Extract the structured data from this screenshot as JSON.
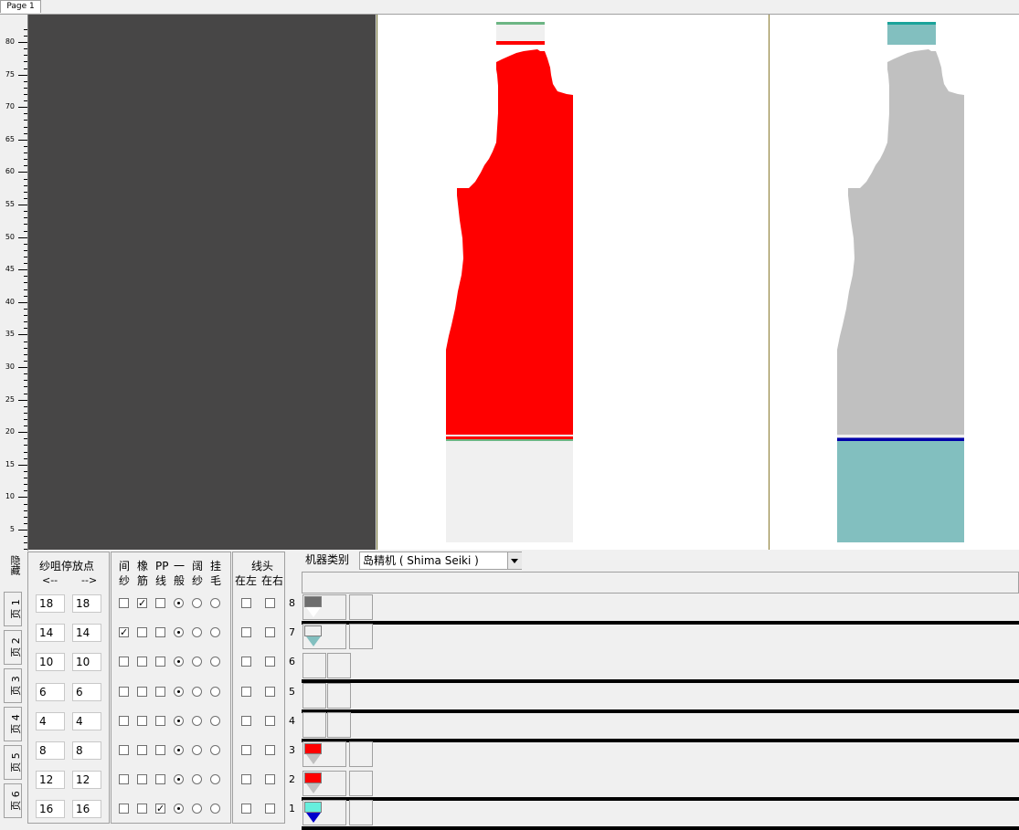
{
  "tabs": [
    {
      "label": "Page 1"
    }
  ],
  "ruler": {
    "labels": [
      "80",
      "75",
      "70",
      "65",
      "60",
      "55",
      "50",
      "45",
      "40",
      "35",
      "30",
      "25",
      "20",
      "15",
      "10",
      "5"
    ]
  },
  "left_panel": {
    "hide_label": "隐藏",
    "pages": [
      "页 1",
      "页 2",
      "页 3",
      "页 4",
      "页 5",
      "页 6"
    ]
  },
  "yarn_stop": {
    "title": "纱咀停放点",
    "left_arrow": "<--",
    "right_arrow": "-->",
    "rows": [
      {
        "left": "18",
        "right": "18"
      },
      {
        "left": "14",
        "right": "14"
      },
      {
        "left": "10",
        "right": "10"
      },
      {
        "left": "6",
        "right": "6"
      },
      {
        "left": "4",
        "right": "4"
      },
      {
        "left": "8",
        "right": "8"
      },
      {
        "left": "12",
        "right": "12"
      },
      {
        "left": "16",
        "right": "16"
      }
    ]
  },
  "options": {
    "headers": [
      {
        "top": "间",
        "bottom": "纱"
      },
      {
        "top": "橡",
        "bottom": "筋"
      },
      {
        "top": "PP",
        "bottom": "线"
      },
      {
        "top": "一",
        "bottom": "般"
      },
      {
        "top": "阔",
        "bottom": "纱"
      },
      {
        "top": "挂",
        "bottom": "毛"
      }
    ],
    "rows": [
      {
        "jian": false,
        "xiang": true,
        "pp": false,
        "mode": 0
      },
      {
        "jian": true,
        "xiang": false,
        "pp": false,
        "mode": 0
      },
      {
        "jian": false,
        "xiang": false,
        "pp": false,
        "mode": 0
      },
      {
        "jian": false,
        "xiang": false,
        "pp": false,
        "mode": 0
      },
      {
        "jian": false,
        "xiang": false,
        "pp": false,
        "mode": 0
      },
      {
        "jian": false,
        "xiang": false,
        "pp": false,
        "mode": 0
      },
      {
        "jian": false,
        "xiang": false,
        "pp": false,
        "mode": 0
      },
      {
        "jian": false,
        "xiang": false,
        "pp": true,
        "mode": 0
      }
    ]
  },
  "thread_end": {
    "title": "线头",
    "left": "在左",
    "right": "在右"
  },
  "machine": {
    "label": "机器类别",
    "value": "岛精机 ( Shima Seiki )"
  },
  "carriers": [
    {
      "num": "8",
      "color": "#6e6e6e",
      "lower": "#ffffff",
      "has_swatch": true
    },
    {
      "num": "7",
      "color": "#f0f0f0",
      "lower": "#82bfbf",
      "has_swatch": true
    },
    {
      "num": "6",
      "color": "",
      "lower": "",
      "has_swatch": false
    },
    {
      "num": "5",
      "color": "",
      "lower": "",
      "has_swatch": false
    },
    {
      "num": "4",
      "color": "",
      "lower": "",
      "has_swatch": false
    },
    {
      "num": "3",
      "color": "#ff0000",
      "lower": "#c0c0c0",
      "has_swatch": true
    },
    {
      "num": "2",
      "color": "#ff0000",
      "lower": "#c0c0c0",
      "has_swatch": true
    },
    {
      "num": "1",
      "color": "#66eedd",
      "lower": "#0000cc",
      "has_swatch": true
    }
  ],
  "colors": {
    "dark_panel": "#474646",
    "garment_red": "#ff0000",
    "garment_grey": "#c0c0c0",
    "rib_light": "#f0f0f0",
    "rib_teal": "#82bfbf",
    "top_green": "#6db584",
    "top_teal": "#1aa39a",
    "stripe_blue": "#0000aa"
  }
}
